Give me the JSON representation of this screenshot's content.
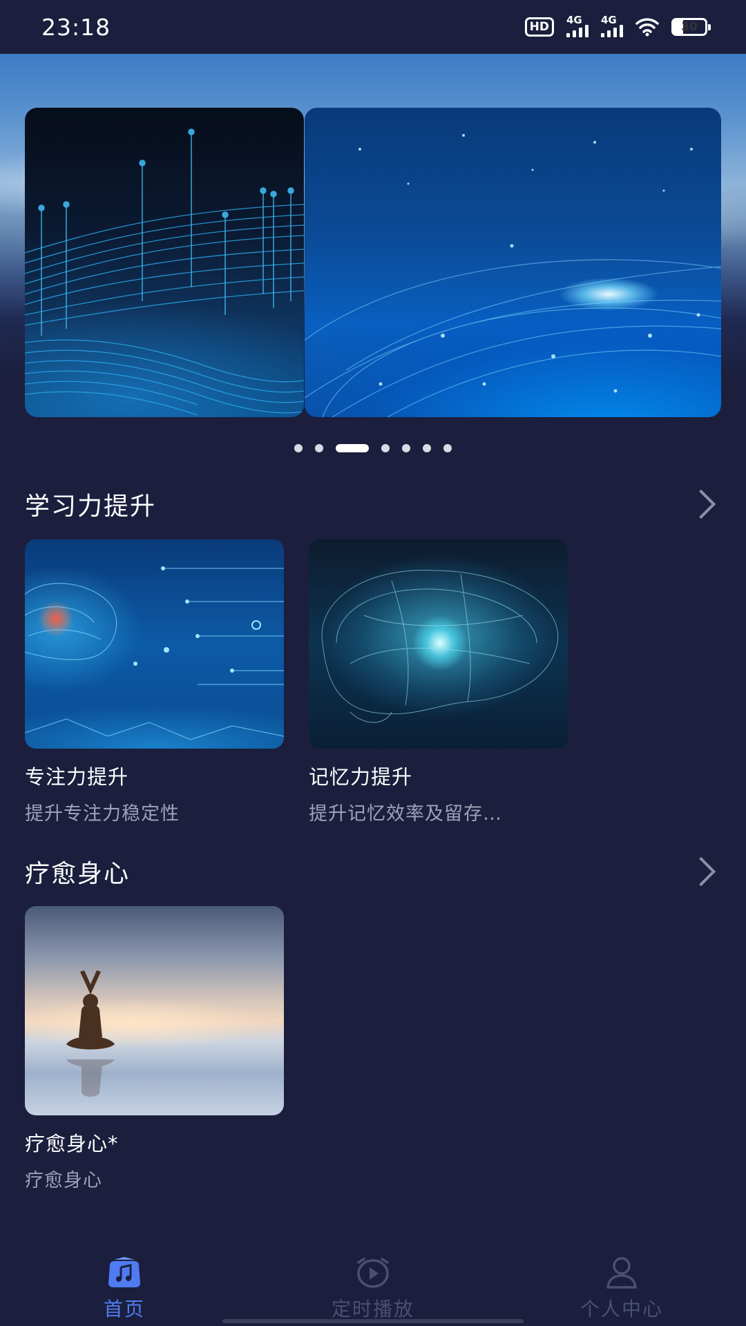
{
  "status_bar": {
    "time": "23:18",
    "hd_label": "HD",
    "signal_1_label": "4G",
    "signal_2_label": "4G",
    "battery_level": "30"
  },
  "banner": {
    "active_index": 2,
    "dot_count": 7
  },
  "sections": [
    {
      "title": "学习力提升",
      "items": [
        {
          "title": "专注力提升",
          "subtitle": "提升专注力稳定性"
        },
        {
          "title": "记忆力提升",
          "subtitle": "提升记忆效率及留存…"
        }
      ]
    },
    {
      "title": "疗愈身心",
      "items": [
        {
          "title": "疗愈身心*",
          "subtitle": "疗愈身心"
        }
      ]
    }
  ],
  "tabbar": {
    "items": [
      {
        "label": "首页",
        "icon": "music-home-icon",
        "active": true
      },
      {
        "label": "定时播放",
        "icon": "alarm-play-icon",
        "active": false
      },
      {
        "label": "个人中心",
        "icon": "user-icon",
        "active": false
      }
    ],
    "active_color": "#4f7cf2",
    "inactive_color": "#4b5070"
  }
}
